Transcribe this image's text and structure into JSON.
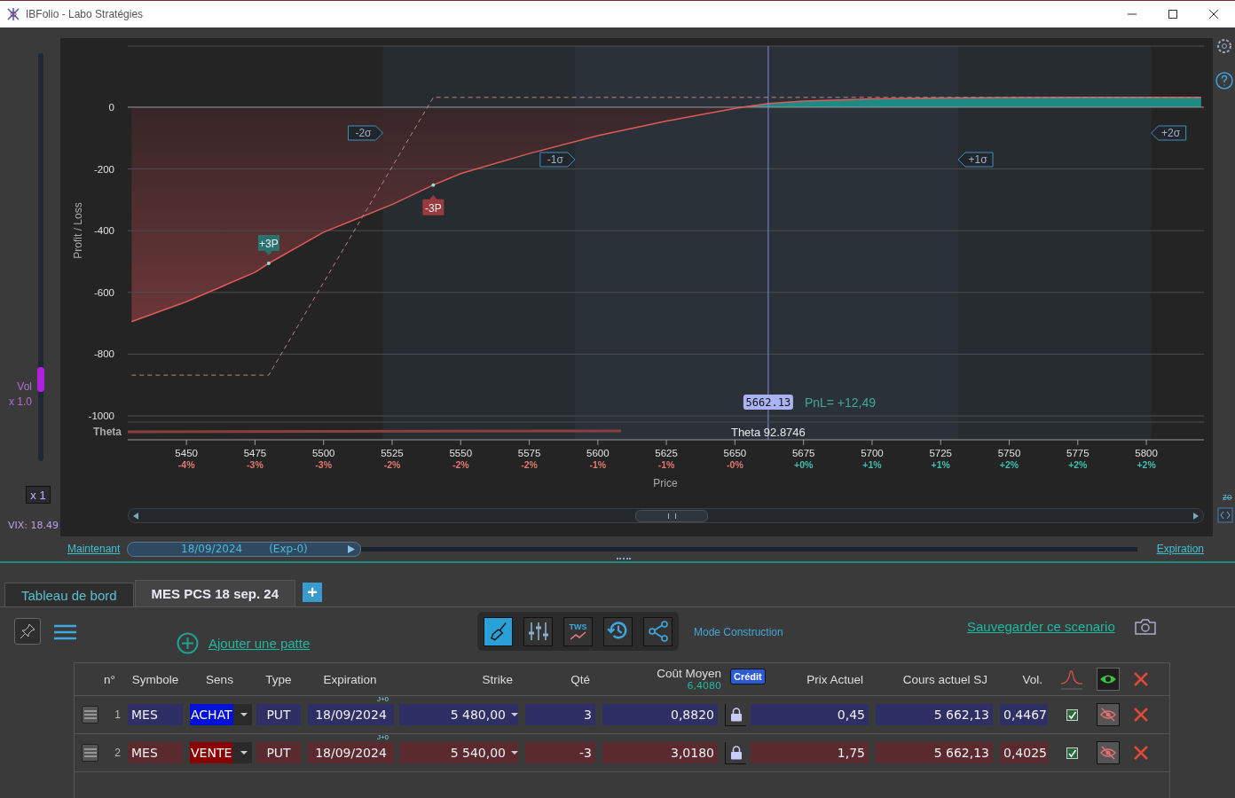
{
  "window": {
    "title": "IBFolio - Labo Stratégies"
  },
  "volatility": {
    "label": "Vol",
    "multiplier": "x 1.0",
    "level": 0.2,
    "reset_button": "x 1",
    "vix": "VIX: 18.49"
  },
  "chart": {
    "theta": {
      "label": "Theta",
      "value": "Theta 92.8746"
    },
    "zoom_label": "zo",
    "sigma_labels": [
      "-2σ",
      "-1σ",
      "+1σ",
      "+2σ"
    ],
    "position_markers": [
      {
        "kind": "long"
      },
      {
        "kind": "short"
      }
    ],
    "tick_changes": [
      {
        "text": "-4%",
        "color": "#e07a70"
      },
      {
        "text": "-3%",
        "color": "#e07a70"
      },
      {
        "text": "-3%",
        "color": "#e07a70"
      },
      {
        "text": "-2%",
        "color": "#e07a70"
      },
      {
        "text": "-2%",
        "color": "#e07a70"
      },
      {
        "text": "-2%",
        "color": "#e07a70"
      },
      {
        "text": "-1%",
        "color": "#e07a70"
      },
      {
        "text": "-1%",
        "color": "#e07a70"
      },
      {
        "text": "-0%",
        "color": "#e07a70"
      },
      {
        "text": "+0%",
        "color": "#3fbfb0"
      },
      {
        "text": "+1%",
        "color": "#3fbfb0"
      },
      {
        "text": "+1%",
        "color": "#3fbfb0"
      },
      {
        "text": "+2%",
        "color": "#3fbfb0"
      },
      {
        "text": "+2%",
        "color": "#3fbfb0"
      },
      {
        "text": "+2%",
        "color": "#3fbfb0"
      }
    ],
    "chart_data": {
      "type": "line",
      "xlabel": "Price",
      "ylabel": "Profit / Loss",
      "grid": true,
      "x": [
        5430,
        5450,
        5475,
        5480,
        5500,
        5525,
        5540,
        5550,
        5575,
        5600,
        5625,
        5650,
        5662.13,
        5675,
        5700,
        5725,
        5750,
        5775,
        5800,
        5820
      ],
      "series": [
        {
          "color": "#e05a5a",
          "values": [
            -695,
            -630,
            -535,
            -506,
            -405,
            -315,
            -252,
            -215,
            -150,
            -92,
            -45,
            -4,
            12,
            20,
            27,
            30,
            31,
            32,
            32,
            32
          ]
        },
        {
          "color": "#c08282",
          "line_style": "dashed",
          "values": [
            -868,
            -868,
            -868,
            -868,
            -568,
            -193,
            32,
            32,
            32,
            32,
            32,
            32,
            32,
            32,
            32,
            32,
            32,
            32,
            32,
            32
          ]
        }
      ],
      "xlim": [
        5428.6,
        5821
      ],
      "ylim": [
        -1000,
        198
      ],
      "xticks": [
        5450,
        5475,
        5500,
        5525,
        5550,
        5575,
        5600,
        5625,
        5650,
        5675,
        5700,
        5725,
        5750,
        5775,
        5800
      ],
      "yticks": [
        0,
        -200,
        -400,
        -600,
        -800,
        -1000
      ],
      "ref_lines": [
        {
          "axis": "x",
          "value": 5662.13,
          "label": "5662.13"
        }
      ],
      "annotations": [
        {
          "text": "+3P",
          "x": 5480,
          "y": -506
        },
        {
          "text": "-3P",
          "x": 5540,
          "y": -252
        },
        "PnL= +12,49"
      ]
    }
  },
  "timeline": {
    "start_link": "Maintenant",
    "date": "18/09/2024",
    "expiry": "(Exp-0)",
    "level": 0.232,
    "end_link": "Expiration"
  },
  "tabs": [
    {
      "label": "Tableau de bord",
      "selected": false
    },
    {
      "label": "MES PCS 18 sep. 24",
      "selected": true
    }
  ],
  "add_tab": "+",
  "toolbar": {
    "add_leg": "Ajouter une patte",
    "modes": [
      {
        "kind": "build",
        "selected": true
      },
      {
        "kind": "sliders",
        "selected": false
      },
      {
        "kind": "tws",
        "label": "TWS",
        "selected": false
      },
      {
        "kind": "history",
        "selected": false
      },
      {
        "kind": "share",
        "selected": false
      }
    ],
    "mode_label": "Mode Construction",
    "save_link": "Sauvegarder ce scenario"
  },
  "table": {
    "columns": [
      "n°",
      "Symbole",
      "Sens",
      "Type",
      "Expiration",
      "Strike",
      "Qté",
      "Coût Moyen",
      "Prix Actuel",
      "Cours actuel SJ",
      "Vol."
    ],
    "total_cost": "6,4080",
    "cost_badge": "Crédit",
    "rows": [
      {
        "kind": "buy",
        "n": "1",
        "symbol": "MES",
        "side": "ACHAT",
        "type": "PUT",
        "expiration": "18/09/2024",
        "day_offset": "J+0",
        "strike": "5 480,00",
        "qty": "3",
        "cost": "0,8820",
        "price": "0,45",
        "underlying": "5 662,13",
        "vol": "0,4467",
        "checked": true
      },
      {
        "kind": "sell",
        "n": "2",
        "symbol": "MES",
        "side": "VENTE",
        "type": "PUT",
        "expiration": "18/09/2024",
        "day_offset": "J+0",
        "strike": "5 540,00",
        "qty": "-3",
        "cost": "3,0180",
        "price": "1,75",
        "underlying": "5 662,13",
        "vol": "0,4025",
        "checked": true
      }
    ]
  }
}
